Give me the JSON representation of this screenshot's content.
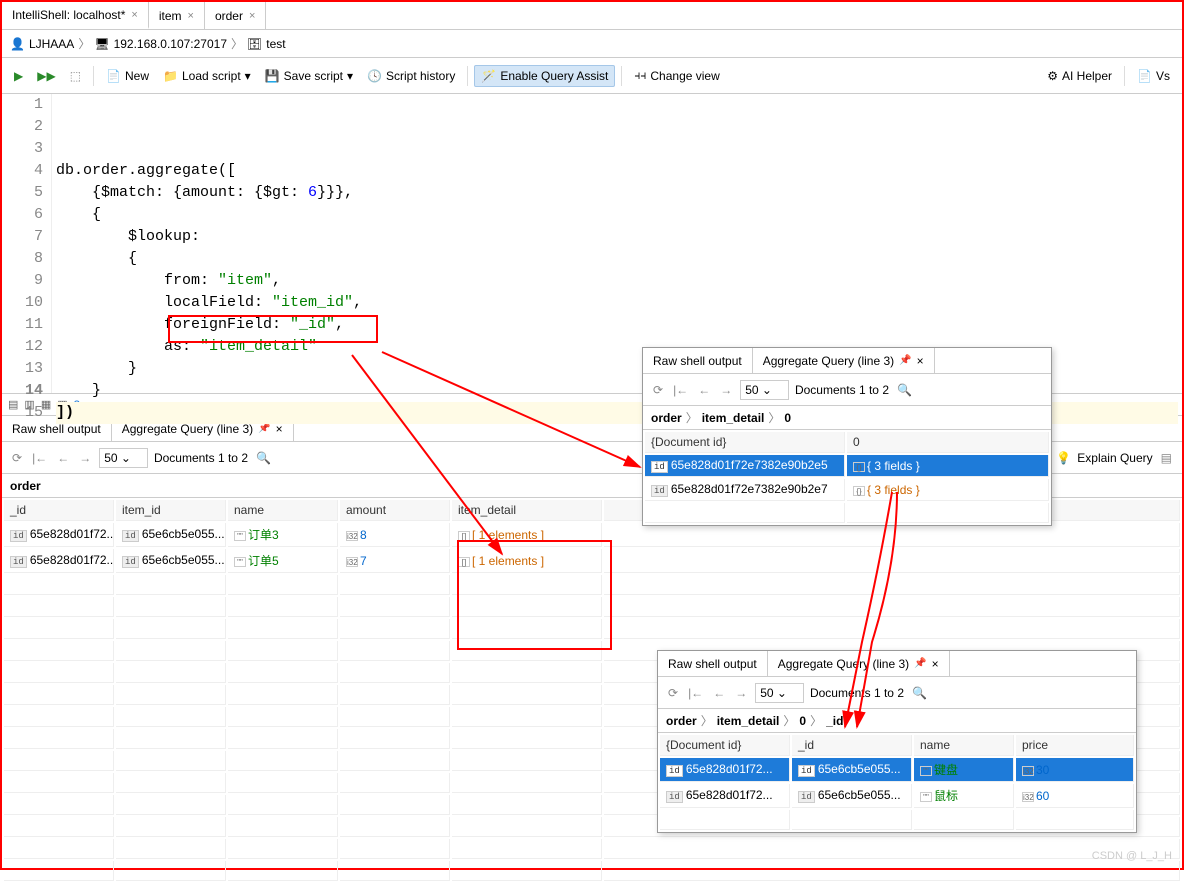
{
  "tabs": [
    {
      "label": "IntelliShell: localhost*",
      "active": true
    },
    {
      "label": "item",
      "active": false
    },
    {
      "label": "order",
      "active": false
    }
  ],
  "breadcrumb": {
    "user": "LJHAAA",
    "host": "192.168.0.107:27017",
    "db": "test"
  },
  "toolbar": {
    "new": "New",
    "load": "Load script",
    "save": "Save script",
    "history": "Script history",
    "enable_assist": "Enable Query Assist",
    "change_view": "Change view",
    "ai_helper": "AI Helper",
    "vs": "Vs"
  },
  "code_lines": [
    "",
    "",
    "db.order.aggregate([",
    "    {$match: {amount: {$gt: 6}}},",
    "    {",
    "        $lookup:",
    "        {",
    "            from: \"item\",",
    "            localField: \"item_id\",",
    "            foreignField: \"_id\",",
    "            as: \"item_detail\"",
    "        }",
    "    }",
    "])",
    ""
  ],
  "results_tabs": {
    "raw": "Raw shell output",
    "agg": "Aggregate Query (line 3)"
  },
  "results_toolbar": {
    "page_size": "50",
    "doc_range": "Documents 1 to 2",
    "explain": "Explain Query"
  },
  "main_breadcrumb": "order",
  "main_table": {
    "headers": [
      "_id",
      "item_id",
      "name",
      "amount",
      "item_detail"
    ],
    "rows": [
      {
        "_id": "65e828d01f72...",
        "item_id": "65e6cb5e055...",
        "name": "订单3",
        "amount": "8",
        "item_detail": "[ 1 elements ]"
      },
      {
        "_id": "65e828d01f72...",
        "item_id": "65e6cb5e055...",
        "name": "订单5",
        "amount": "7",
        "item_detail": "[ 1 elements ]"
      }
    ]
  },
  "popup1": {
    "breadcrumb": [
      "order",
      "item_detail",
      "0"
    ],
    "headers": [
      "{Document id}",
      "0"
    ],
    "rows": [
      {
        "docid": "65e828d01f72e7382e90b2e5",
        "val": "{ 3 fields }",
        "selected": true
      },
      {
        "docid": "65e828d01f72e7382e90b2e7",
        "val": "{ 3 fields }",
        "selected": false
      }
    ]
  },
  "popup2": {
    "breadcrumb": [
      "order",
      "item_detail",
      "0",
      "_id"
    ],
    "headers": [
      "{Document id}",
      "_id",
      "name",
      "price"
    ],
    "rows": [
      {
        "docid": "65e828d01f72...",
        "_id": "65e6cb5e055...",
        "name": "键盘",
        "price": "30",
        "selected": true
      },
      {
        "docid": "65e828d01f72...",
        "_id": "65e6cb5e055...",
        "name": "鼠标",
        "price": "60",
        "selected": false
      }
    ]
  },
  "watermark": "CSDN @ L_J_H"
}
